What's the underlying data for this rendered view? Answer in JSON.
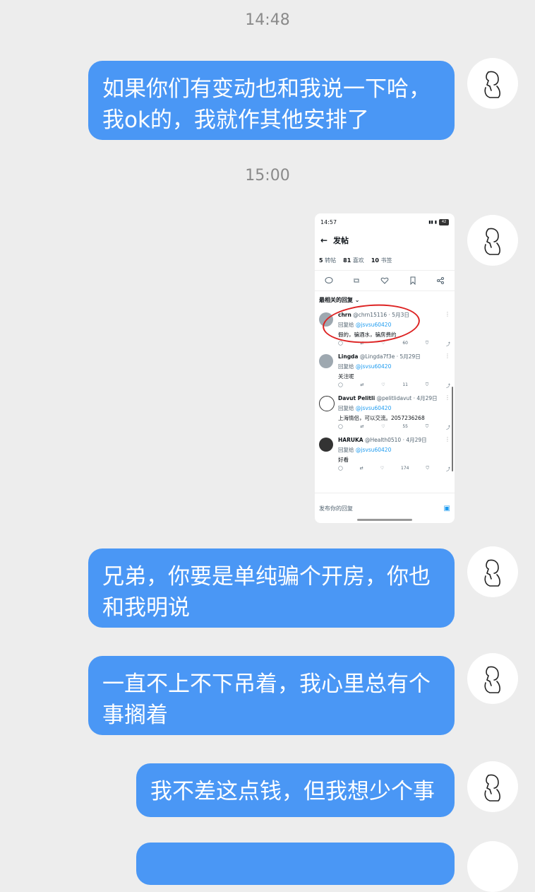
{
  "timestamps": [
    "14:48",
    "15:00"
  ],
  "messages": [
    {
      "text": "如果你们有变动也和我说一下哈，我ok的，我就作其他安排了"
    },
    {
      "text": "兄弟，你要是单纯骗个开房，你也和我明说"
    },
    {
      "text": "一直不上不下吊着，我心里总有个事搁着"
    },
    {
      "text": "我不差这点钱，但我想少个事"
    }
  ],
  "screenshot": {
    "status_time": "14:57",
    "battery": "42",
    "title": "发帖",
    "stats": {
      "reposts_num": "5",
      "reposts_label": "转帖",
      "likes_num": "81",
      "likes_label": "喜欢",
      "bookmarks_num": "10",
      "bookmarks_label": "书签"
    },
    "sort_label": "最相关的回复 ⌄",
    "replies": [
      {
        "name": "chrn",
        "handle": "@chrn15116 · 5月3日",
        "reply_to": "回复给",
        "to_handle": "@jsvsu60420",
        "text": "假的，骗酒水，骗房费的",
        "views": "60"
      },
      {
        "name": "Lingda",
        "handle": "@Lingda7f3e · 5月29日",
        "reply_to": "回复给",
        "to_handle": "@jsvsu60420",
        "text": "关注呢",
        "views": "11"
      },
      {
        "name": "Davut Pelitli",
        "handle": "@pelitlidavut · 4月29日",
        "reply_to": "回复给",
        "to_handle": "@jsvsu60420",
        "text": "上海情侣，可以交流。2057236268",
        "views": "55"
      },
      {
        "name": "HARUKA",
        "handle": "@Health0510 · 4月29日",
        "reply_to": "回复给",
        "to_handle": "@jsvsu60420",
        "text": "好看",
        "views": "174"
      }
    ],
    "compose_placeholder": "发布你的回复"
  },
  "colors": {
    "bubble": "#4a97f5",
    "background": "#ededed",
    "annotation": "#dd2222"
  },
  "icons": [
    "person-line-avatar-icon",
    "back-arrow-icon",
    "reply-icon",
    "repost-icon",
    "like-icon",
    "bookmark-icon",
    "share-icon",
    "camera-icon"
  ]
}
